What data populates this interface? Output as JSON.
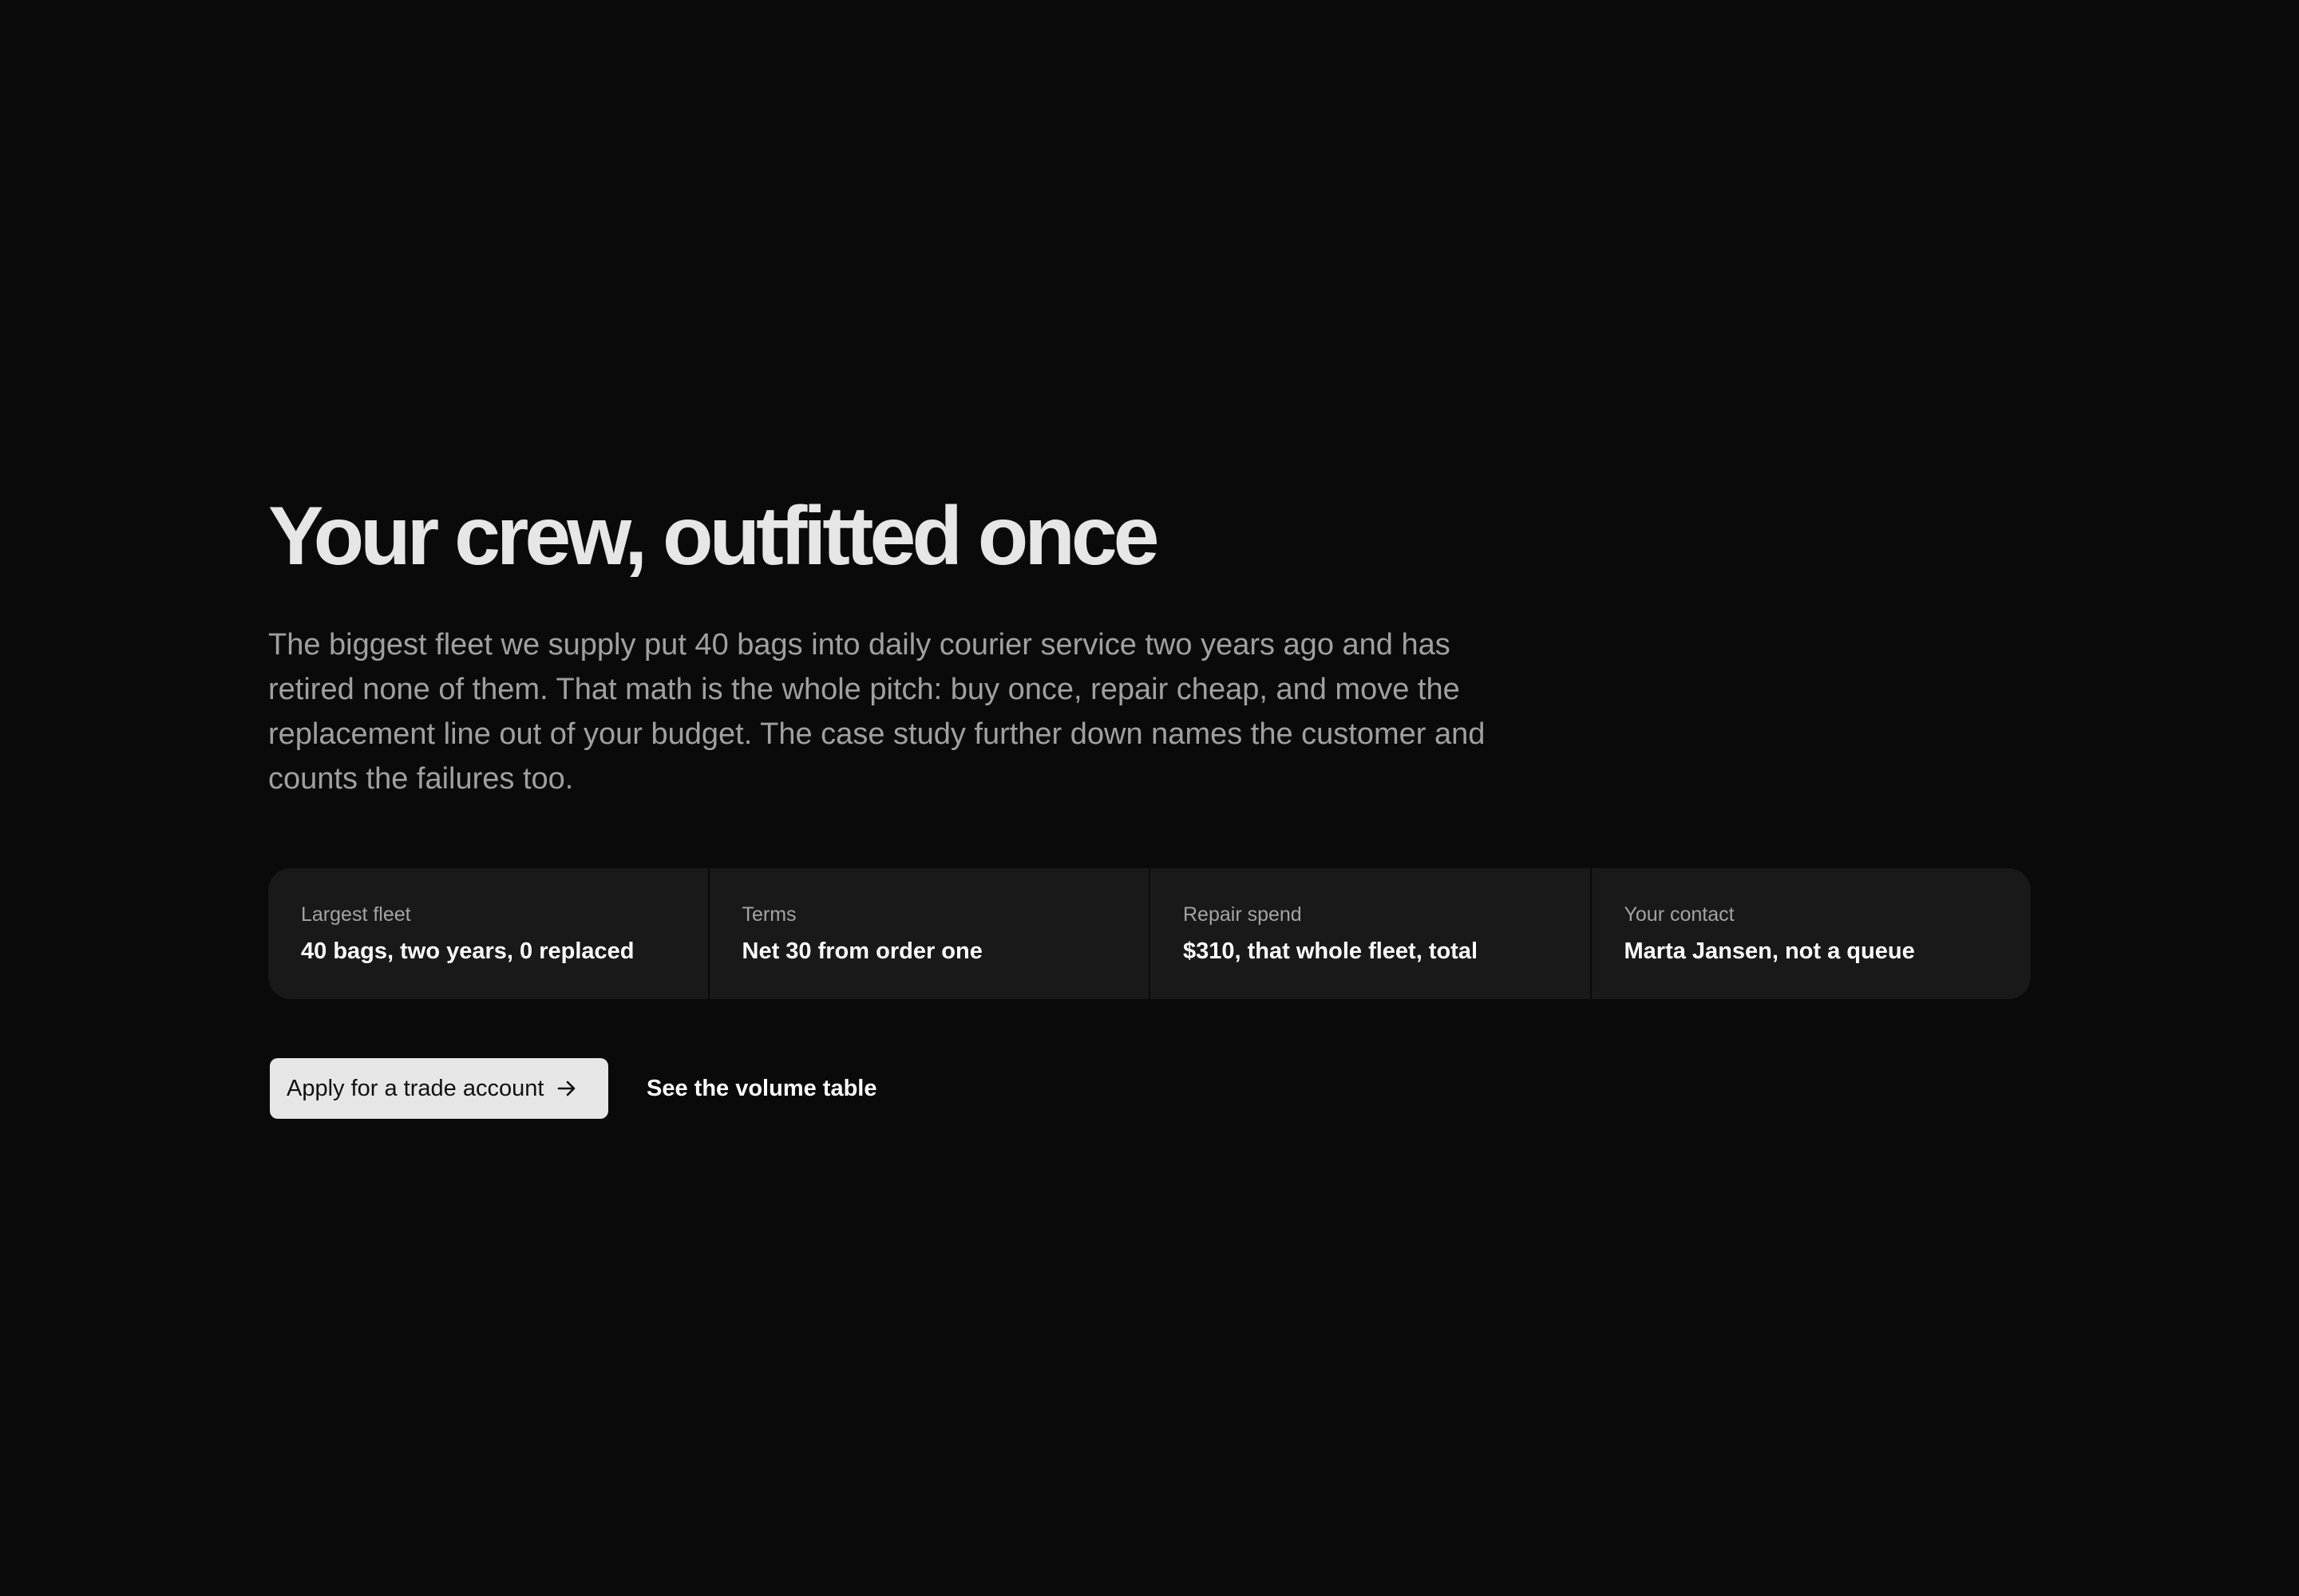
{
  "hero": {
    "title": "Your crew, outfitted once",
    "intro": "The biggest fleet we supply put 40 bags into daily courier service two years ago and has retired none of them. That math is the whole pitch: buy once, repair cheap, and move the replacement line out of your budget. The case study further down names the customer and counts the failures too."
  },
  "stats": [
    {
      "label": "Largest fleet",
      "value": "40 bags, two years, 0 replaced"
    },
    {
      "label": "Terms",
      "value": "Net 30 from order one"
    },
    {
      "label": "Repair spend",
      "value": "$310, that whole fleet, total"
    },
    {
      "label": "Your contact",
      "value": "Marta Jansen, not a queue"
    }
  ],
  "actions": {
    "primary_label": "Apply for a trade account",
    "primary_icon": "arrow-right-icon",
    "secondary_label": "See the volume table"
  }
}
